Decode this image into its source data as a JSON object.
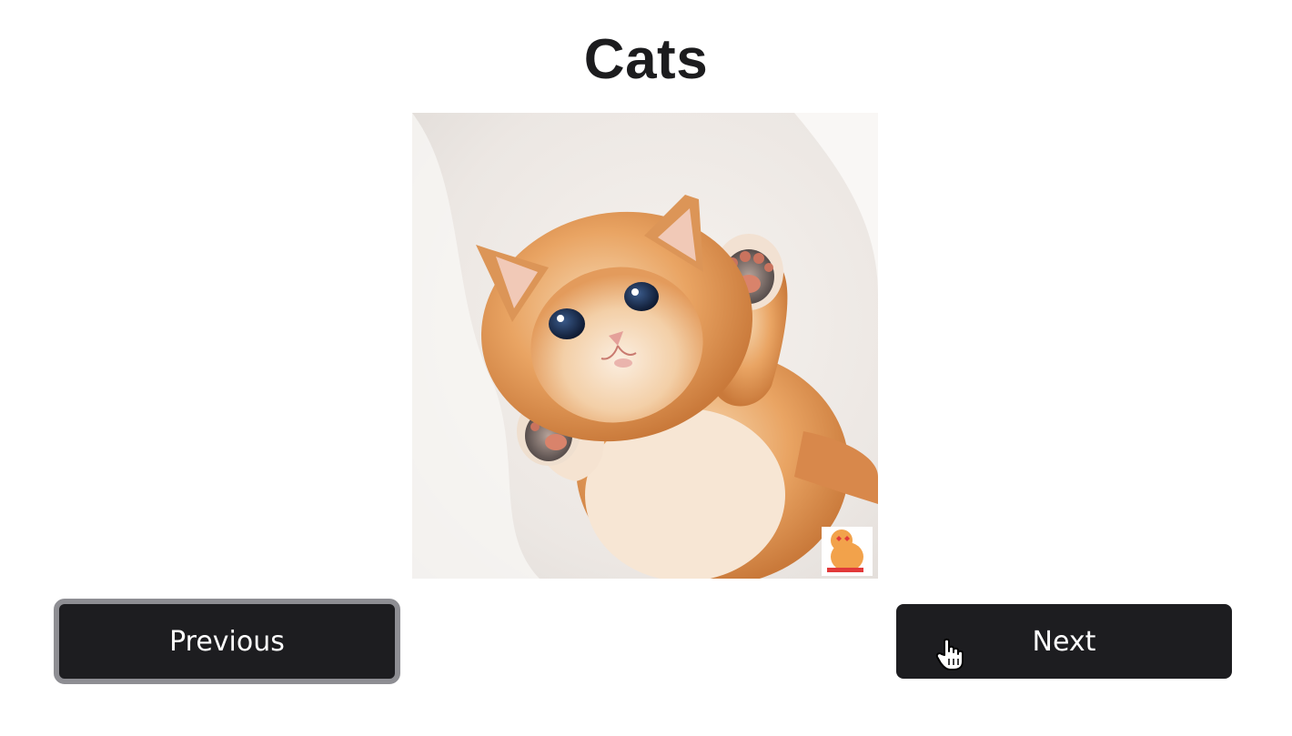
{
  "title": "Cats",
  "gallery": {
    "image_alt": "Orange kitten lying on a white blanket with its paws raised",
    "previous_label": "Previous",
    "next_label": "Next"
  },
  "colors": {
    "button_bg": "#1d1d20",
    "focus_ring": "#8e8e93",
    "title_text": "#1c1c1e"
  },
  "icons": {
    "cursor": "hand-pointer-icon"
  }
}
